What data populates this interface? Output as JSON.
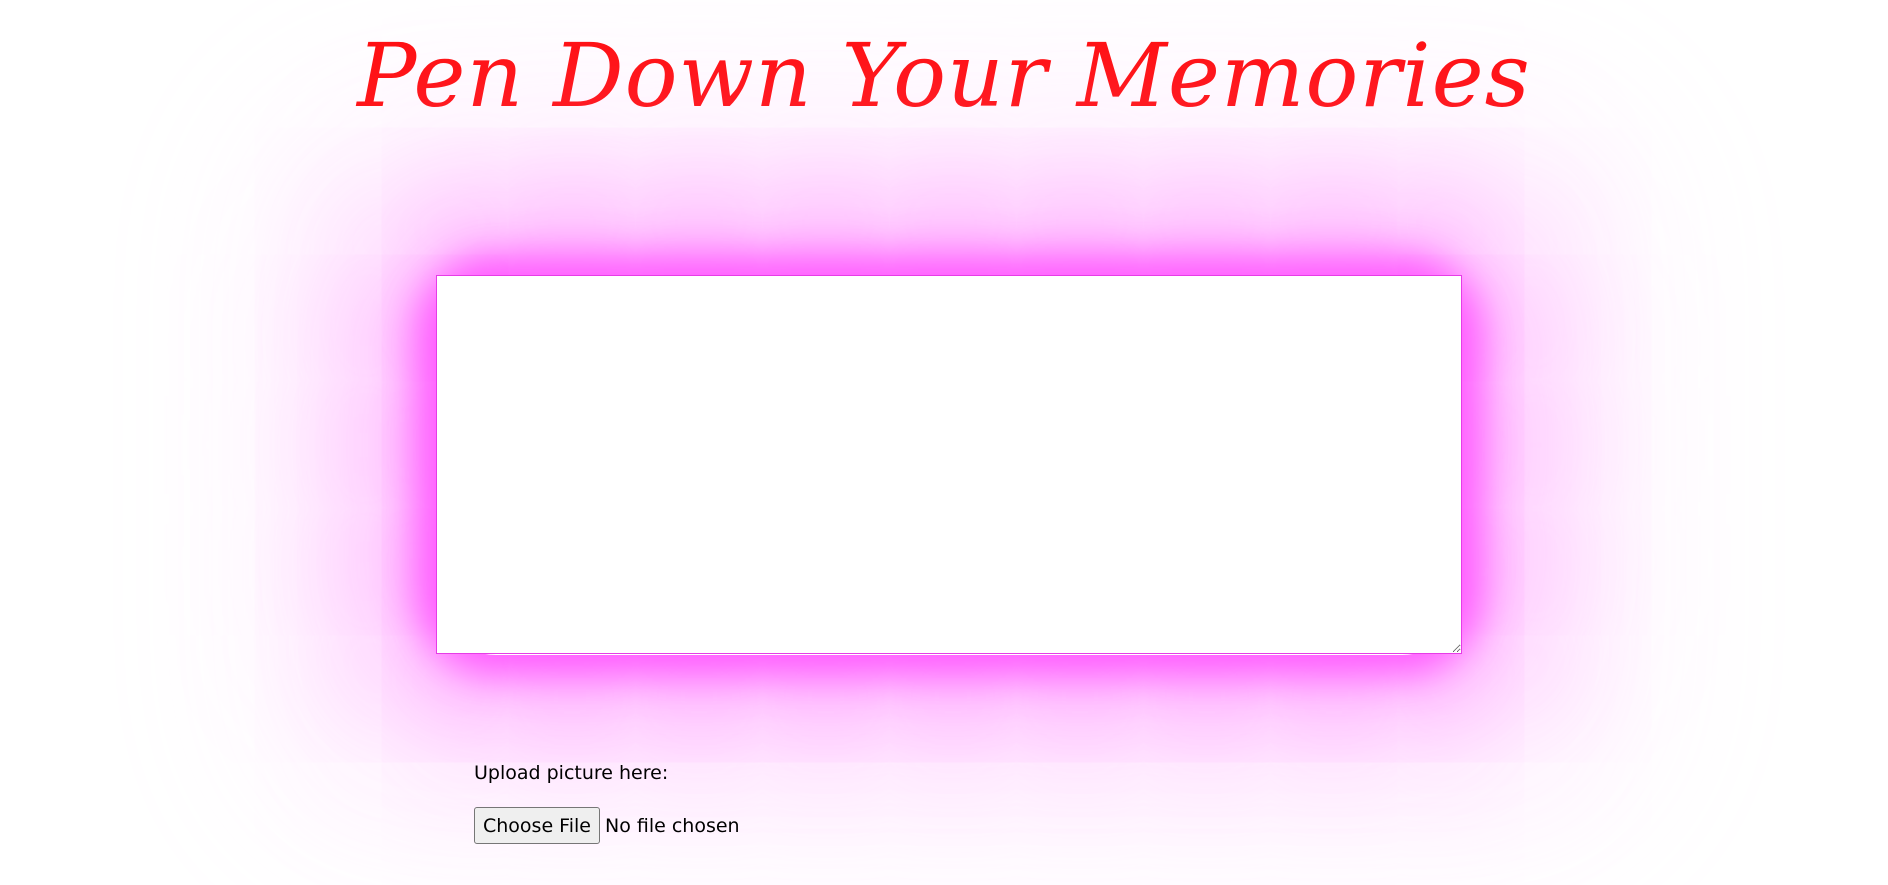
{
  "header": {
    "title": "Pen Down Your Memories"
  },
  "memory_form": {
    "textarea_value": "",
    "upload_label": "Upload picture here:",
    "choose_file_label": "Choose File",
    "file_status": "No file chosen"
  },
  "colors": {
    "title": "#ff0d0d",
    "glow": "#ff4dff",
    "textarea_border": "#e63ce6",
    "background": "#ffffff"
  }
}
